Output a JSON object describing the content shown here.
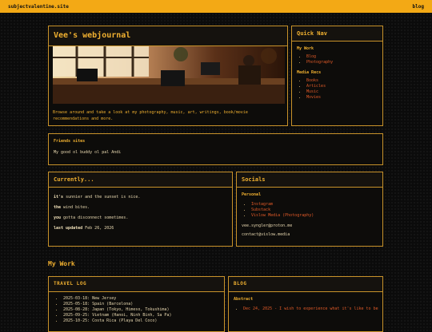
{
  "topbar": {
    "site": "subjectvalentine.site",
    "blog_link": "blog"
  },
  "title_panel": {
    "title": "Vee's webjournal",
    "description": "Browse around and take a look at my photography, music, art, writings, book/movie recommendations and more."
  },
  "quicknav": {
    "title": "Quick Nav",
    "my_work_label": "My Work",
    "my_work_items": [
      "Blog",
      "Photography"
    ],
    "media_recs_label": "Media Recs",
    "media_recs_items": [
      "Books",
      "Articles",
      "Music",
      "Movies"
    ]
  },
  "friends": {
    "label": "Friends sites",
    "text": "My good ol buddy ol pal Andi"
  },
  "currently": {
    "title": "Currently...",
    "line1_bold": "it's",
    "line1_rest": "sunnier and the sunset is nice.",
    "line2_bold": "the",
    "line2_rest": "wind bites.",
    "line3_bold": "you",
    "line3_rest": "gotta disconnect sometimes.",
    "updated_bold": "last updated",
    "updated_date": "Feb 26, 2026"
  },
  "socials": {
    "title": "Socials",
    "personal_label": "Personal",
    "links": [
      "Instagram",
      "Substack",
      "Vislow Media (Photography)"
    ],
    "email1": "vee.syngler@proton.me",
    "email2": "contact@vislow.media"
  },
  "my_work_heading": "My Work",
  "travel": {
    "title": "TRAVEL LOG",
    "entries": [
      "2025-03-18: New Jersey",
      "2025-05-18: Spain (Barcelona)",
      "2025-08-28: Japan (Tokyo, Himeso, Tokushima)",
      "2025-09-25: Vietnam (Hanoi, Ninh Binh, Sa Pa)",
      "2025-10-25: Costa Rica (Playa Del Coco)"
    ]
  },
  "blog": {
    "title": "BLOG",
    "abstract_label": "Abstract",
    "entry_date": "Dec 24, 2025",
    "entry_text": "I wish to experience what it's like to be"
  },
  "colors": {
    "accent": "#f3a915",
    "link": "#e05a28",
    "border": "#c8922a"
  }
}
